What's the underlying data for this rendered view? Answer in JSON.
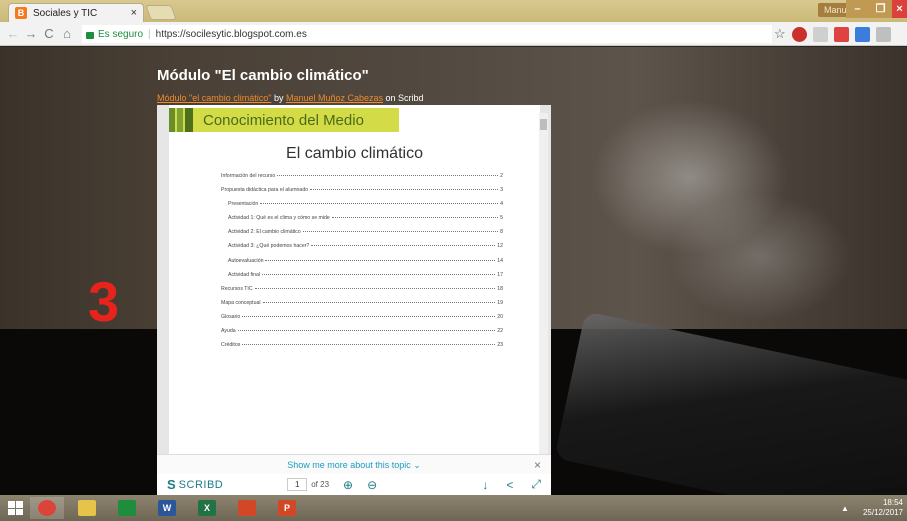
{
  "browser": {
    "tab_title": "Sociales y TIC",
    "tab_close": "×",
    "user_name": "Manuel",
    "win_min": "–",
    "win_max": "❐",
    "win_close": "×",
    "secure_label": "Es seguro",
    "url": "https://socilesytic.blogspot.com.es",
    "star": "☆",
    "accent": "#f47a20"
  },
  "page": {
    "title": "Módulo \"El cambio climático\"",
    "embed_link_text": "Módulo \"el cambio climático\"",
    "embed_by": " by ",
    "embed_author": "Manuel Muñoz Cabezas",
    "embed_on": " on Scribd",
    "number_label": "3",
    "number_color": "#e8231c"
  },
  "document": {
    "banner": "Conocimiento del Medio",
    "title": "El cambio climático",
    "toc": [
      {
        "label": "Información del recurso",
        "page": "2",
        "indent": false
      },
      {
        "label": "Propuesta didáctica para el alumnado",
        "page": "3",
        "indent": false
      },
      {
        "label": "Presentación",
        "page": "4",
        "indent": true
      },
      {
        "label": "Actividad 1: Qué es el clima y cómo se mide",
        "page": "5",
        "indent": true
      },
      {
        "label": "Actividad 2: El cambio climático",
        "page": "8",
        "indent": true
      },
      {
        "label": "Actividad 3: ¿Qué podemos hacer?",
        "page": "12",
        "indent": true
      },
      {
        "label": "Autoevaluación",
        "page": "14",
        "indent": true
      },
      {
        "label": "Actividad final",
        "page": "17",
        "indent": true
      },
      {
        "label": "Recursos TIC",
        "page": "18",
        "indent": false
      },
      {
        "label": "Mapa conceptual",
        "page": "19",
        "indent": false
      },
      {
        "label": "Glosario",
        "page": "20",
        "indent": false
      },
      {
        "label": "Ayuda",
        "page": "22",
        "indent": false
      },
      {
        "label": "Créditos",
        "page": "23",
        "indent": false
      }
    ]
  },
  "scribd": {
    "show_more": "Show me more about this topic ⌄",
    "close": "×",
    "logo": "SCRIBD",
    "current_page": "1",
    "total_pages": "of 23",
    "zoom_in": "⊕",
    "zoom_out": "⊖",
    "download": "↓",
    "share": "<",
    "fullscreen": "⤢"
  },
  "taskbar": {
    "apps": [
      {
        "name": "chrome",
        "label": "",
        "color": "#db4437"
      },
      {
        "name": "file-explorer",
        "label": "",
        "color": "#e8c34a"
      },
      {
        "name": "store",
        "label": "",
        "color": "#1e8e3e"
      },
      {
        "name": "word",
        "label": "W",
        "color": "#2b579a"
      },
      {
        "name": "excel",
        "label": "X",
        "color": "#217346"
      },
      {
        "name": "office",
        "label": "",
        "color": "#d24726"
      },
      {
        "name": "powerpoint",
        "label": "P",
        "color": "#d24726"
      }
    ],
    "time": "18:54",
    "date": "25/12/2017"
  }
}
